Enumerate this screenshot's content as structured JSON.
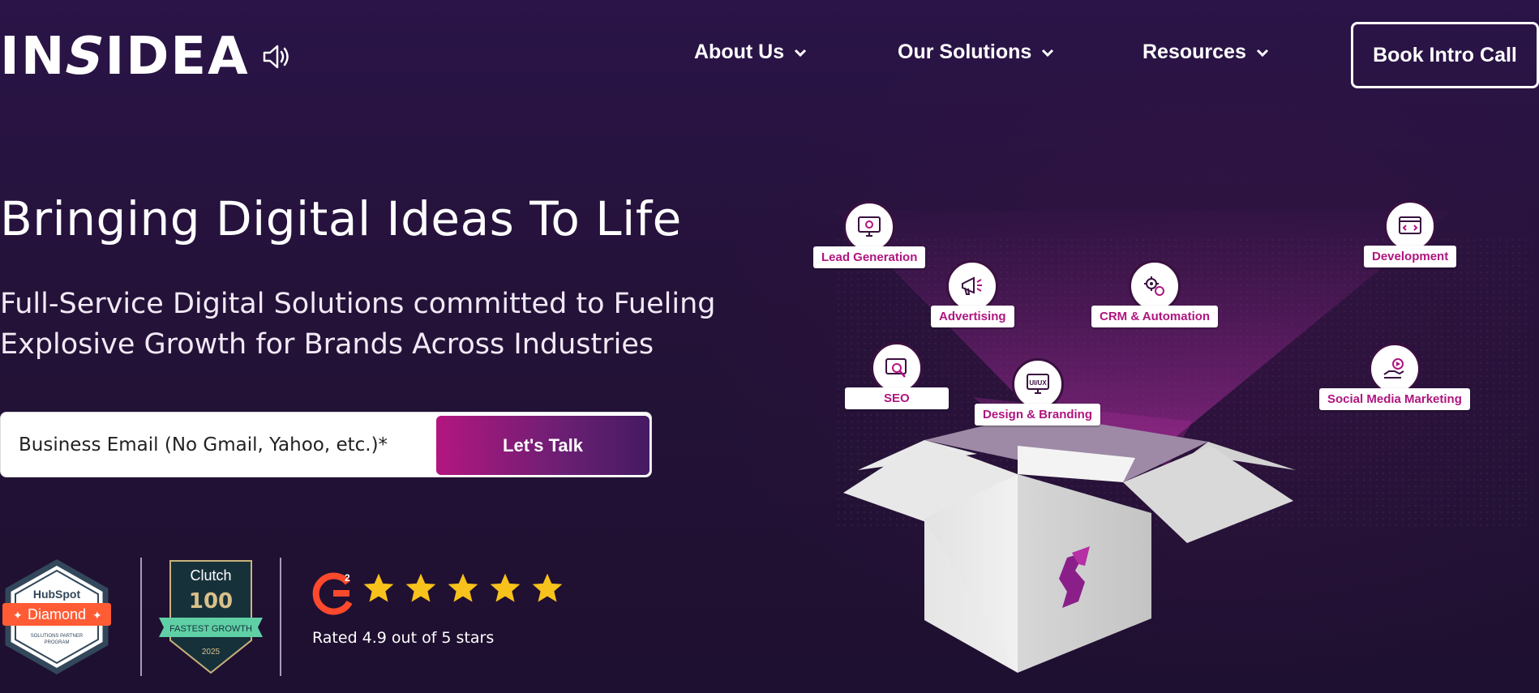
{
  "logo": {
    "text_a": "IN",
    "text_b": "S",
    "text_c": "IDEA"
  },
  "nav": {
    "items": [
      {
        "label": "About Us"
      },
      {
        "label": "Our Solutions"
      },
      {
        "label": "Resources"
      }
    ],
    "cta_label": "Book Intro Call"
  },
  "hero": {
    "headline": "Bringing Digital Ideas To Life",
    "subheadline_line1": "Full-Service Digital Solutions committed to Fueling",
    "subheadline_line2": "Explosive Growth for Brands Across Industries",
    "email_placeholder": "Business Email (No Gmail, Yahoo, etc.)*",
    "submit_label": "Let's Talk"
  },
  "badges": {
    "hubspot": {
      "brand": "HubSpot",
      "tier": "Diamond",
      "program_line1": "SOLUTIONS PARTNER",
      "program_line2": "PROGRAM"
    },
    "clutch": {
      "brand": "Clutch",
      "rank": "100",
      "ribbon": "FASTEST GROWTH",
      "year": "2025"
    },
    "g2": {
      "logo": "G2",
      "stars": 5,
      "rating_text": "Rated 4.9 out of 5 stars"
    }
  },
  "services": [
    {
      "label": "Lead Generation",
      "icon": "monitor-gear-icon"
    },
    {
      "label": "Development",
      "icon": "code-window-icon"
    },
    {
      "label": "Advertising",
      "icon": "megaphone-icon"
    },
    {
      "label": "CRM & Automation",
      "icon": "gears-icon"
    },
    {
      "label": "SEO",
      "icon": "search-chart-icon"
    },
    {
      "label": "Design & Branding",
      "icon": "ui-ux-icon"
    },
    {
      "label": "Social Media Marketing",
      "icon": "hand-social-icon"
    }
  ],
  "colors": {
    "accent_magenta": "#b0157f",
    "accent_purple": "#451a63",
    "background": "#241238",
    "star": "#f7c21b"
  }
}
